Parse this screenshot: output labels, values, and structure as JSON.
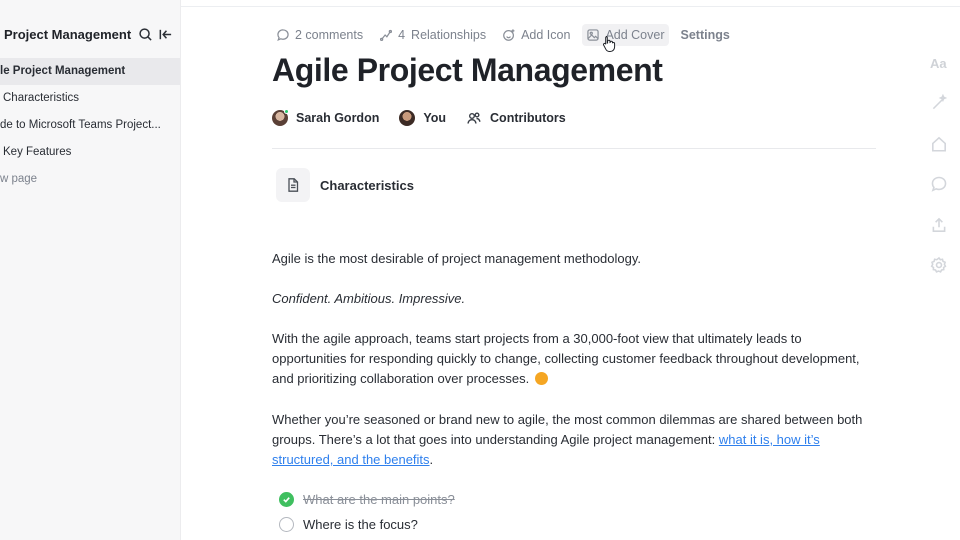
{
  "sidebar": {
    "title": "Project Management",
    "items": [
      {
        "label": "le Project Management",
        "active": true
      },
      {
        "label": "Characteristics",
        "active": false
      },
      {
        "label": "de to Microsoft Teams Project...",
        "active": false
      },
      {
        "label": "Key Features",
        "active": false
      },
      {
        "label": "w page",
        "active": false
      }
    ]
  },
  "toolbar": {
    "comments": "2 comments",
    "relationships_count": "4",
    "relationships_label": "Relationships",
    "add_icon": "Add Icon",
    "add_cover": "Add Cover",
    "settings": "Settings"
  },
  "page": {
    "title": "Agile Project Management"
  },
  "authors": {
    "author1": "Sarah Gordon",
    "author2": "You",
    "contributors": "Contributors"
  },
  "subpage": {
    "label": "Characteristics",
    "icon": "document-icon"
  },
  "body": {
    "p1": "Agile is the most desirable of project management methodology.",
    "p2": "Confident. Ambitious. Impressive.",
    "p3": "With the agile approach, teams start projects from a 30,000-foot view that ultimately leads to opportunities for responding quickly to change, collecting customer feedback throughout development, and prioritizing collaboration over processes.",
    "p4_prefix": "Whether you’re seasoned or brand new to agile, the most common dilemmas are shared between both groups. There’s a lot that goes into understanding Agile project management: ",
    "p4_link": "what it is, how it’s structured, and the benefits",
    "p4_suffix": "."
  },
  "checklist": [
    {
      "label": "What are the main points?",
      "done": true
    },
    {
      "label": "Where is the focus?",
      "done": false
    }
  ],
  "right_rail": {
    "font_label": "Aa"
  },
  "colors": {
    "accent_link": "#2f80ed",
    "check_done": "#3fbf5f",
    "online": "#2ecc71"
  }
}
